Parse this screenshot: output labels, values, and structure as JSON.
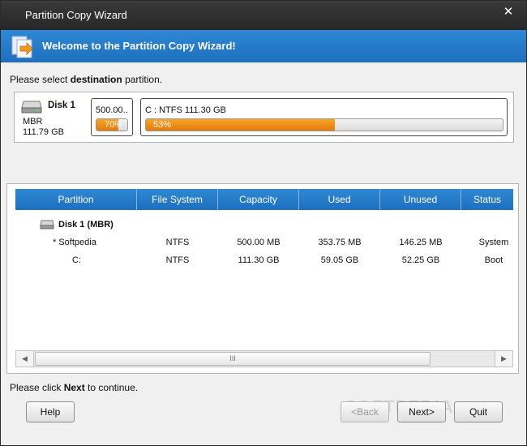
{
  "window": {
    "title": "Partition Copy Wizard",
    "close_glyph": "✕"
  },
  "banner": {
    "heading": "Welcome to the Partition Copy Wizard!",
    "icon": "wizard-copy-icon"
  },
  "instruction": {
    "prefix": "Please select ",
    "emphasis": "destination",
    "suffix": " partition."
  },
  "disk_map": {
    "disk_name": "Disk 1",
    "disk_type": "MBR",
    "disk_size": "111.79 GB",
    "partitions": [
      {
        "label": "500.00..",
        "percent_text": "70%",
        "used_fraction": 0.7
      },
      {
        "label": "C : NTFS 111.30 GB",
        "percent_text": "53%",
        "used_fraction": 0.53
      }
    ]
  },
  "table": {
    "columns": [
      "Partition",
      "File System",
      "Capacity",
      "Used",
      "Unused",
      "Status"
    ],
    "disk_row_label": "Disk 1 (MBR)",
    "rows": [
      {
        "partition": "*  Softpedia",
        "file_system": "NTFS",
        "capacity": "500.00 MB",
        "used": "353.75 MB",
        "unused": "146.25 MB",
        "status": "System"
      },
      {
        "partition": "C:",
        "file_system": "NTFS",
        "capacity": "111.30 GB",
        "used": "59.05 GB",
        "unused": "52.25 GB",
        "status": "Boot"
      }
    ]
  },
  "scrollbar": {
    "left_glyph": "◀",
    "right_glyph": "▶",
    "grip": "III"
  },
  "footer": {
    "prefix": "Please click ",
    "emphasis": "Next",
    "suffix": " to continue."
  },
  "buttons": {
    "help": "Help",
    "back": "<Back",
    "next": "Next>",
    "quit": "Quit"
  },
  "watermark": "SOFTPEDIA",
  "colors": {
    "banner_blue": "#1d6fbe",
    "bar_orange": "#e5790c"
  }
}
